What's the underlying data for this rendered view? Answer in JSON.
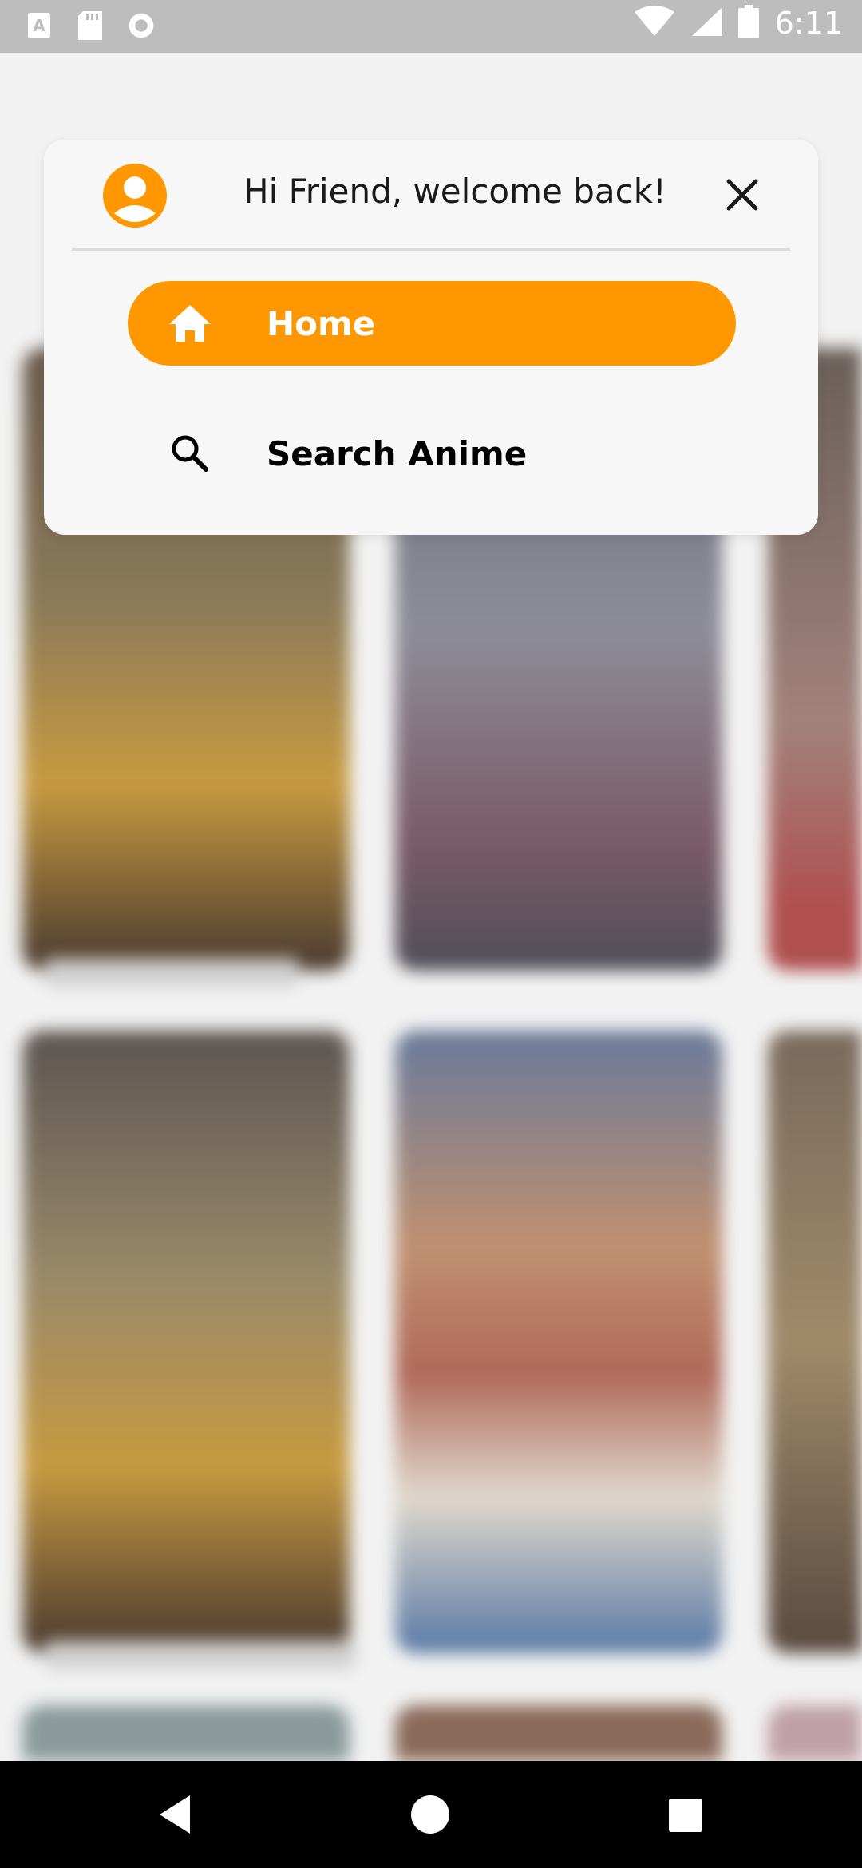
{
  "status_bar": {
    "time": "6:11",
    "left_icons": [
      "a-icon",
      "sd-card-icon",
      "circle-record-icon"
    ],
    "right_icons": [
      "wifi-icon",
      "cell-signal-icon",
      "battery-icon"
    ]
  },
  "menu": {
    "welcome_text": "Hi Friend, welcome back!",
    "avatar_icon": "user-circle-icon",
    "close_icon": "close-icon",
    "items": [
      {
        "label": "Home",
        "icon": "home-icon",
        "active": true
      },
      {
        "label": "Search Anime",
        "icon": "search-icon",
        "active": false
      }
    ]
  },
  "colors": {
    "accent": "#ff9800",
    "status_bar": "#bdbdbd",
    "nav_bar": "#000000"
  },
  "nav_bar": {
    "buttons": [
      "back-icon",
      "home-circle-icon",
      "recents-icon"
    ]
  }
}
